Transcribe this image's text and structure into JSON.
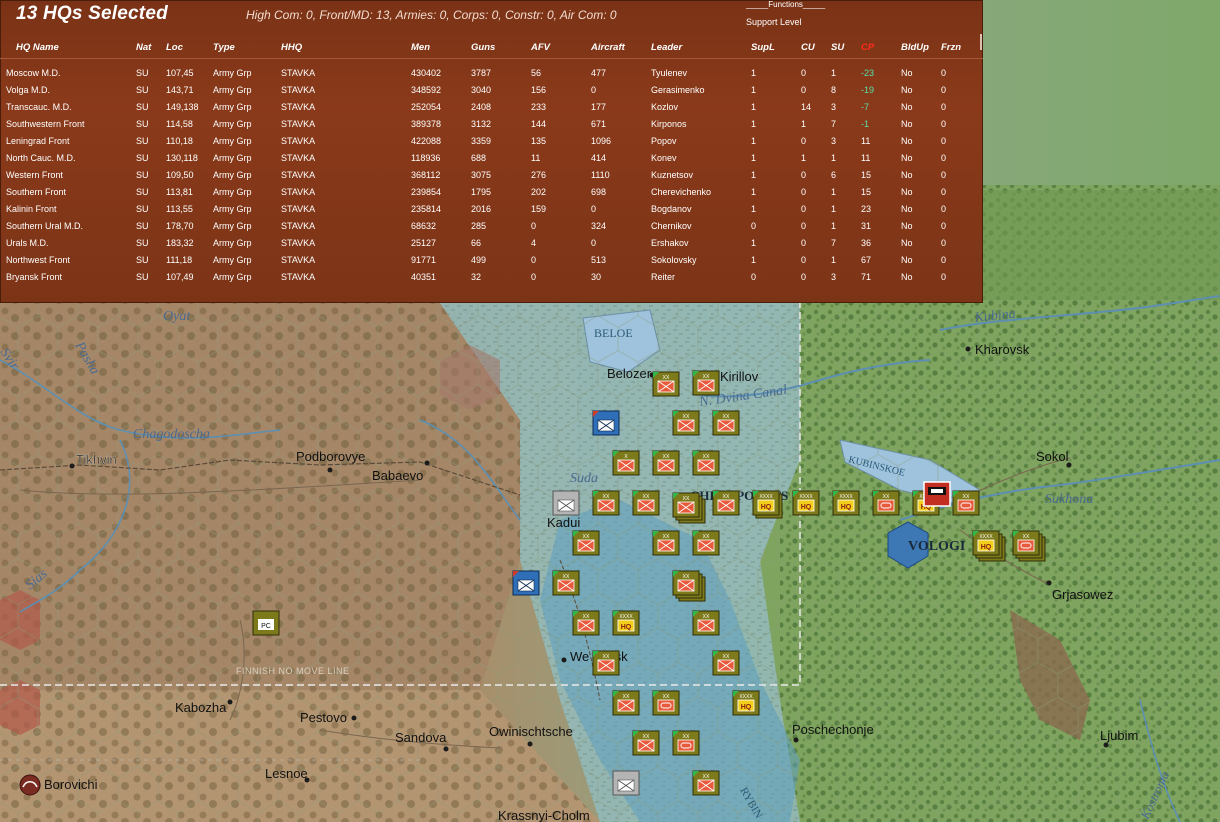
{
  "panel": {
    "title": "13 HQs Selected",
    "summary": "High Com: 0, Front/MD: 13, Armies: 0, Corps: 0, Constr: 0, Air Com: 0",
    "functions_label": "_____Functions_____",
    "support_level_label": "Support Level",
    "columns": {
      "hq_name": "HQ Name",
      "nat": "Nat",
      "loc": "Loc",
      "type": "Type",
      "hhq": "HHQ",
      "men": "Men",
      "guns": "Guns",
      "afv": "AFV",
      "aircraft": "Aircraft",
      "leader": "Leader",
      "supl": "SupL",
      "cu": "CU",
      "su": "SU",
      "cp": "CP",
      "bldup": "BldUp",
      "frzn": "Frzn"
    },
    "rows": [
      {
        "name": "Moscow M.D.",
        "nat": "SU",
        "loc": "107,45",
        "type": "Army Grp",
        "hhq": "STAVKA",
        "men": "430402",
        "guns": "3787",
        "afv": "56",
        "aircraft": "477",
        "leader": "Tyulenev",
        "supl": "1",
        "cu": "0",
        "su": "1",
        "cp": "-23",
        "bldup": "No",
        "frzn": "0"
      },
      {
        "name": "Volga M.D.",
        "nat": "SU",
        "loc": "143,71",
        "type": "Army Grp",
        "hhq": "STAVKA",
        "men": "348592",
        "guns": "3040",
        "afv": "156",
        "aircraft": "0",
        "leader": "Gerasimenko",
        "supl": "1",
        "cu": "0",
        "su": "8",
        "cp": "-19",
        "bldup": "No",
        "frzn": "0"
      },
      {
        "name": "Transcauc. M.D.",
        "nat": "SU",
        "loc": "149,138",
        "type": "Army Grp",
        "hhq": "STAVKA",
        "men": "252054",
        "guns": "2408",
        "afv": "233",
        "aircraft": "177",
        "leader": "Kozlov",
        "supl": "1",
        "cu": "14",
        "su": "3",
        "cp": "-7",
        "bldup": "No",
        "frzn": "0"
      },
      {
        "name": "Southwestern Front",
        "nat": "SU",
        "loc": "114,58",
        "type": "Army Grp",
        "hhq": "STAVKA",
        "men": "389378",
        "guns": "3132",
        "afv": "144",
        "aircraft": "671",
        "leader": "Kirponos",
        "supl": "1",
        "cu": "1",
        "su": "7",
        "cp": "-1",
        "bldup": "No",
        "frzn": "0"
      },
      {
        "name": "Leningrad Front",
        "nat": "SU",
        "loc": "110,18",
        "type": "Army Grp",
        "hhq": "STAVKA",
        "men": "422088",
        "guns": "3359",
        "afv": "135",
        "aircraft": "1096",
        "leader": "Popov",
        "supl": "1",
        "cu": "0",
        "su": "3",
        "cp": "11",
        "bldup": "No",
        "frzn": "0"
      },
      {
        "name": "North Cauc. M.D.",
        "nat": "SU",
        "loc": "130,118",
        "type": "Army Grp",
        "hhq": "STAVKA",
        "men": "118936",
        "guns": "688",
        "afv": "11",
        "aircraft": "414",
        "leader": "Konev",
        "supl": "1",
        "cu": "1",
        "su": "1",
        "cp": "11",
        "bldup": "No",
        "frzn": "0"
      },
      {
        "name": "Western Front",
        "nat": "SU",
        "loc": "109,50",
        "type": "Army Grp",
        "hhq": "STAVKA",
        "men": "368112",
        "guns": "3075",
        "afv": "276",
        "aircraft": "1110",
        "leader": "Kuznetsov",
        "supl": "1",
        "cu": "0",
        "su": "6",
        "cp": "15",
        "bldup": "No",
        "frzn": "0"
      },
      {
        "name": "Southern Front",
        "nat": "SU",
        "loc": "113,81",
        "type": "Army Grp",
        "hhq": "STAVKA",
        "men": "239854",
        "guns": "1795",
        "afv": "202",
        "aircraft": "698",
        "leader": "Cherevichenko",
        "supl": "1",
        "cu": "0",
        "su": "1",
        "cp": "15",
        "bldup": "No",
        "frzn": "0"
      },
      {
        "name": "Kalinin Front",
        "nat": "SU",
        "loc": "113,55",
        "type": "Army Grp",
        "hhq": "STAVKA",
        "men": "235814",
        "guns": "2016",
        "afv": "159",
        "aircraft": "0",
        "leader": "Bogdanov",
        "supl": "1",
        "cu": "0",
        "su": "1",
        "cp": "23",
        "bldup": "No",
        "frzn": "0"
      },
      {
        "name": "Southern Ural M.D.",
        "nat": "SU",
        "loc": "178,70",
        "type": "Army Grp",
        "hhq": "STAVKA",
        "men": "68632",
        "guns": "285",
        "afv": "0",
        "aircraft": "324",
        "leader": "Chernikov",
        "supl": "0",
        "cu": "0",
        "su": "1",
        "cp": "31",
        "bldup": "No",
        "frzn": "0"
      },
      {
        "name": "Urals M.D.",
        "nat": "SU",
        "loc": "183,32",
        "type": "Army Grp",
        "hhq": "STAVKA",
        "men": "25127",
        "guns": "66",
        "afv": "4",
        "aircraft": "0",
        "leader": "Ershakov",
        "supl": "1",
        "cu": "0",
        "su": "7",
        "cp": "36",
        "bldup": "No",
        "frzn": "0"
      },
      {
        "name": "Northwest Front",
        "nat": "SU",
        "loc": "111,18",
        "type": "Army Grp",
        "hhq": "STAVKA",
        "men": "91771",
        "guns": "499",
        "afv": "0",
        "aircraft": "513",
        "leader": "Sokolovsky",
        "supl": "1",
        "cu": "0",
        "su": "1",
        "cp": "67",
        "bldup": "No",
        "frzn": "0"
      },
      {
        "name": "Bryansk Front",
        "nat": "SU",
        "loc": "107,49",
        "type": "Army Grp",
        "hhq": "STAVKA",
        "men": "40351",
        "guns": "32",
        "afv": "0",
        "aircraft": "30",
        "leader": "Reiter",
        "supl": "0",
        "cu": "0",
        "su": "3",
        "cp": "71",
        "bldup": "No",
        "frzn": "0"
      }
    ]
  },
  "map": {
    "labels": {
      "tikhvin": "Tikhvin",
      "podborovye": "Podborovye",
      "babaevo": "Babaevo",
      "kadui": "Kadui",
      "belozersk": "Belozer",
      "kirillov": "Kirillov",
      "kharovsk": "Kharovsk",
      "sokol": "Sokol",
      "vologda": "VOLOGI",
      "grjasowez": "Grjasowez",
      "vesyegonsk": "We gonsk",
      "kabozha": "Kabozha",
      "pestovo": "Pestovo",
      "sandova": "Sandova",
      "owinischtsche": "Owinischtsche",
      "poschechonje": "Poschechonje",
      "ljubim": "Ljubim",
      "lesnoe": "Lesnoe",
      "krasnyi": "Krassnyi-Cholm",
      "borovichi": "Borovichi",
      "beloe": "BELOE",
      "kubinskoe": "KUBINSKOE",
      "rybinsk": "RYBIN",
      "oyat": "Oyat",
      "pasha": "Pasha",
      "svir": "Svir",
      "syas": "Sias",
      "chagodoscha": "Chagodoscha",
      "suda": "Suda",
      "dvina_canal": "N. Dvina Canal",
      "kubina": "Kubina",
      "sukhona": "Sukhona",
      "kostroma": "Kostroma",
      "finnish_line": "FINNISH NO MOVE LINE",
      "cherepovets": "CHEREPOVETS"
    },
    "unit_symbols": {
      "hq": "HQ",
      "pc": "PC",
      "xx": "XX",
      "x": "X",
      "xxx": "XXX",
      "xxxx": "XXXX",
      "ii": "II"
    },
    "colors": {
      "soviet_counter": "#7d7a1c",
      "soviet_hq": "#f2cf1a",
      "german_counter": "#2f6fb8",
      "red_symbol": "#e85a3c",
      "panel_bg": "#7c3417"
    }
  }
}
